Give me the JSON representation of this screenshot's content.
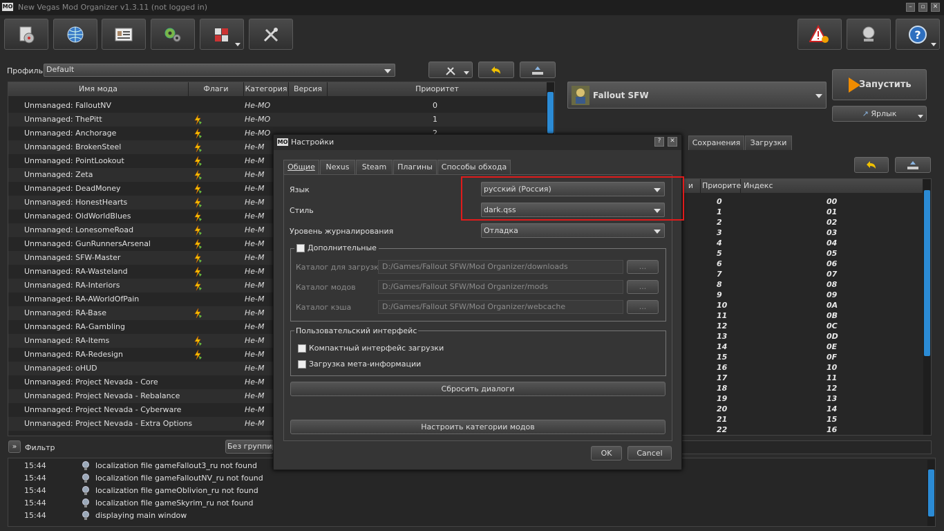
{
  "app": {
    "title": "New Vegas Mod Organizer v1.3.11 (not logged in)",
    "logo": "MO"
  },
  "window_controls": [
    "minimize-icon",
    "maximize-icon",
    "close-icon"
  ],
  "toolbar": {
    "buttons": [
      "install-mod-icon",
      "nexus-globe-icon",
      "profiles-icon",
      "executables-gears-icon",
      "tools-puzzle-icon",
      "settings-tools-icon"
    ],
    "right_buttons": [
      "problems-warning-icon",
      "endorse-icon",
      "help-icon"
    ]
  },
  "profile": {
    "label": "Профиль",
    "value": "Default"
  },
  "modlist": {
    "headers": [
      "Имя мода",
      "Флаги",
      "Категория",
      "Версия",
      "Приоритет"
    ],
    "rows": [
      {
        "name": "Unmanaged: FalloutNV",
        "flag": false,
        "cat": "Не-MO",
        "prio": "0"
      },
      {
        "name": "Unmanaged: ThePitt",
        "flag": true,
        "cat": "Не-MO",
        "prio": "1"
      },
      {
        "name": "Unmanaged: Anchorage",
        "flag": true,
        "cat": "Не-MO",
        "prio": "2"
      },
      {
        "name": "Unmanaged: BrokenSteel",
        "flag": true,
        "cat": "Не-M",
        "prio": ""
      },
      {
        "name": "Unmanaged: PointLookout",
        "flag": true,
        "cat": "Не-M",
        "prio": ""
      },
      {
        "name": "Unmanaged: Zeta",
        "flag": true,
        "cat": "Не-M",
        "prio": ""
      },
      {
        "name": "Unmanaged: DeadMoney",
        "flag": true,
        "cat": "Не-M",
        "prio": ""
      },
      {
        "name": "Unmanaged: HonestHearts",
        "flag": true,
        "cat": "Не-M",
        "prio": ""
      },
      {
        "name": "Unmanaged: OldWorldBlues",
        "flag": true,
        "cat": "Не-M",
        "prio": ""
      },
      {
        "name": "Unmanaged: LonesomeRoad",
        "flag": true,
        "cat": "Не-M",
        "prio": ""
      },
      {
        "name": "Unmanaged: GunRunnersArsenal",
        "flag": true,
        "cat": "Не-M",
        "prio": ""
      },
      {
        "name": "Unmanaged: SFW-Master",
        "flag": true,
        "cat": "Не-M",
        "prio": ""
      },
      {
        "name": "Unmanaged: RA-Wasteland",
        "flag": true,
        "cat": "Не-M",
        "prio": ""
      },
      {
        "name": "Unmanaged: RA-Interiors",
        "flag": true,
        "cat": "Не-M",
        "prio": ""
      },
      {
        "name": "Unmanaged: RA-AWorldOfPain",
        "flag": false,
        "cat": "Не-M",
        "prio": ""
      },
      {
        "name": "Unmanaged: RA-Base",
        "flag": true,
        "cat": "Не-M",
        "prio": ""
      },
      {
        "name": "Unmanaged: RA-Gambling",
        "flag": false,
        "cat": "Не-M",
        "prio": ""
      },
      {
        "name": "Unmanaged: RA-Items",
        "flag": true,
        "cat": "Не-M",
        "prio": ""
      },
      {
        "name": "Unmanaged: RA-Redesign",
        "flag": true,
        "cat": "Не-M",
        "prio": ""
      },
      {
        "name": "Unmanaged: oHUD",
        "flag": false,
        "cat": "Не-M",
        "prio": ""
      },
      {
        "name": "Unmanaged: Project Nevada - Core",
        "flag": false,
        "cat": "Не-M",
        "prio": ""
      },
      {
        "name": "Unmanaged: Project Nevada - Rebalance",
        "flag": false,
        "cat": "Не-M",
        "prio": ""
      },
      {
        "name": "Unmanaged: Project Nevada - Cyberware",
        "flag": false,
        "cat": "Не-M",
        "prio": ""
      },
      {
        "name": "Unmanaged: Project Nevada - Extra Options",
        "flag": false,
        "cat": "Не-M",
        "prio": ""
      }
    ]
  },
  "filter": {
    "label": "Фильтр",
    "grouping": "Без группиро"
  },
  "launcher": {
    "game": "Fallout SFW",
    "run_label": "Запустить",
    "shortcut_label": "Ярлык"
  },
  "right_tabs": [
    "Сохранения",
    "Загрузки"
  ],
  "plugins": {
    "headers": [
      "и",
      "Приорите",
      "Индекс"
    ],
    "rows": [
      [
        "0",
        "00"
      ],
      [
        "1",
        "01"
      ],
      [
        "2",
        "02"
      ],
      [
        "3",
        "03"
      ],
      [
        "4",
        "04"
      ],
      [
        "5",
        "05"
      ],
      [
        "6",
        "06"
      ],
      [
        "7",
        "07"
      ],
      [
        "8",
        "08"
      ],
      [
        "9",
        "09"
      ],
      [
        "10",
        "0A"
      ],
      [
        "11",
        "0B"
      ],
      [
        "12",
        "0C"
      ],
      [
        "13",
        "0D"
      ],
      [
        "14",
        "0E"
      ],
      [
        "15",
        "0F"
      ],
      [
        "16",
        "10"
      ],
      [
        "17",
        "11"
      ],
      [
        "18",
        "12"
      ],
      [
        "19",
        "13"
      ],
      [
        "20",
        "14"
      ],
      [
        "21",
        "15"
      ],
      [
        "22",
        "16"
      ]
    ]
  },
  "log": [
    {
      "time": "15:44",
      "msg": "localization file gameFallout3_ru not found"
    },
    {
      "time": "15:44",
      "msg": "localization file gameFalloutNV_ru not found"
    },
    {
      "time": "15:44",
      "msg": "localization file gameOblivion_ru not found"
    },
    {
      "time": "15:44",
      "msg": "localization file gameSkyrim_ru not found"
    },
    {
      "time": "15:44",
      "msg": "displaying main window"
    }
  ],
  "dialog": {
    "logo": "MO",
    "title": "Настройки",
    "help": "?",
    "close": "✕",
    "tabs": [
      "Общие",
      "Nexus",
      "Steam",
      "Плагины",
      "Способы обхода"
    ],
    "language_label": "Язык",
    "language_value": "русский (Россия)",
    "style_label": "Стиль",
    "style_value": "dark.qss",
    "log_level_label": "Уровень журналирования",
    "log_level_value": "Отладка",
    "advanced_label": "Дополнительные",
    "download_dir_label": "Каталог для загрузки",
    "download_dir_value": "D:/Games/Fallout SFW/Mod Organizer/downloads",
    "mods_dir_label": "Каталог модов",
    "mods_dir_value": "D:/Games/Fallout SFW/Mod Organizer/mods",
    "cache_dir_label": "Каталог кэша",
    "cache_dir_value": "D:/Games/Fallout SFW/Mod Organizer/webcache",
    "browse": "...",
    "ui_group_label": "Пользовательский интерфейс",
    "compact_label": "Компактный интерфейс загрузки",
    "meta_label": "Загрузка мета-информации",
    "reset_dialogs": "Сбросить диалоги",
    "configure_categories": "Настроить категории модов",
    "ok": "OK",
    "cancel": "Cancel"
  },
  "colors": {
    "highlight": "#e01b1b",
    "scroll_thumb": "#2b8bd5",
    "background": "#2b2b2b"
  }
}
